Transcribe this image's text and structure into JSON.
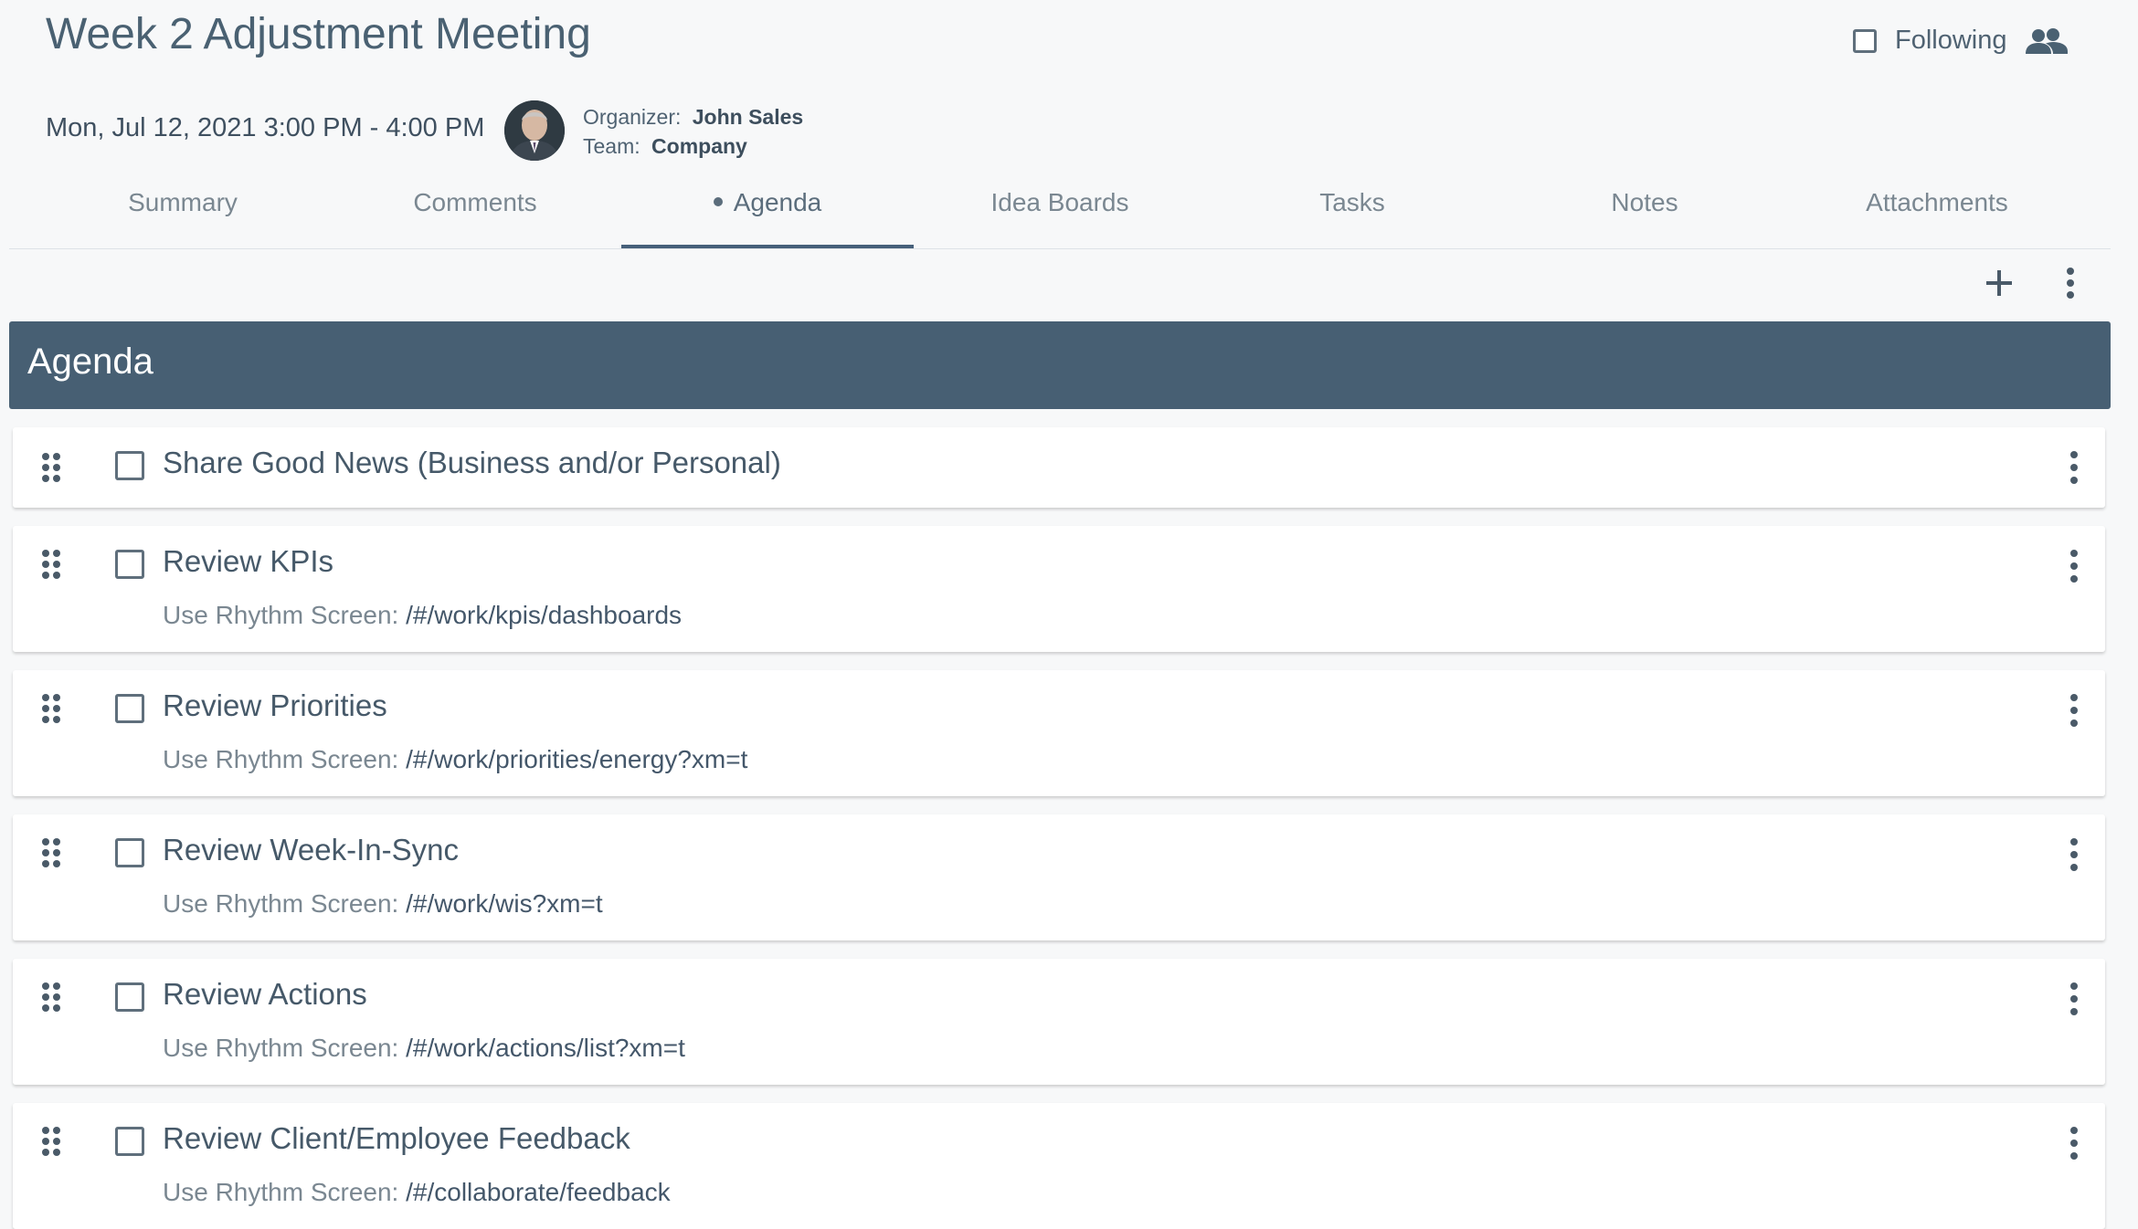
{
  "meeting": {
    "title": "Week 2 Adjustment Meeting",
    "datetime": "Mon, Jul 12, 2021 3:00 PM - 4:00 PM",
    "organizer_label": "Organizer:",
    "organizer_name": "John Sales",
    "team_label": "Team:",
    "team_name": "Company",
    "following_label": "Following"
  },
  "tabs": [
    {
      "label": "Summary"
    },
    {
      "label": "Comments"
    },
    {
      "label": "Agenda",
      "active": true
    },
    {
      "label": "Idea Boards"
    },
    {
      "label": "Tasks"
    },
    {
      "label": "Notes"
    },
    {
      "label": "Attachments"
    }
  ],
  "agenda": {
    "header": "Agenda",
    "items": [
      {
        "title": "Share Good News (Business and/or Personal)",
        "sub_label": "",
        "sub_path": ""
      },
      {
        "title": "Review KPIs",
        "sub_label": "Use Rhythm Screen:",
        "sub_path": "/#/work/kpis/dashboards"
      },
      {
        "title": "Review Priorities",
        "sub_label": "Use Rhythm Screen:",
        "sub_path": "/#/work/priorities/energy?xm=t"
      },
      {
        "title": "Review Week-In-Sync",
        "sub_label": "Use Rhythm Screen:",
        "sub_path": "/#/work/wis?xm=t"
      },
      {
        "title": "Review Actions",
        "sub_label": "Use Rhythm Screen:",
        "sub_path": "/#/work/actions/list?xm=t"
      },
      {
        "title": "Review Client/Employee Feedback",
        "sub_label": "Use Rhythm Screen:",
        "sub_path": "/#/collaborate/feedback"
      }
    ]
  },
  "icons": {
    "people": "people-icon",
    "add": "add-icon",
    "more": "more-vert-icon",
    "drag": "drag-handle-icon"
  },
  "colors": {
    "header_bar": "#475f73",
    "tab_underline": "#46607a",
    "text": "#4f6272"
  }
}
